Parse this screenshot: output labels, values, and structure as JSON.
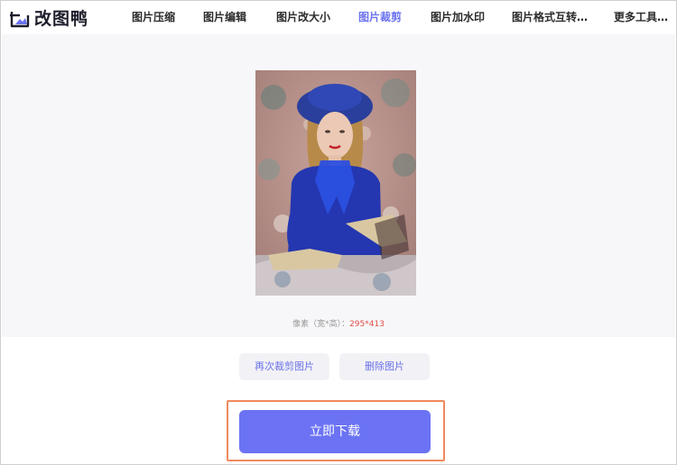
{
  "app": {
    "name": "改图鸭",
    "logo_icon": "image-duck-logo-icon"
  },
  "nav": [
    {
      "label": "图片压缩",
      "active": false
    },
    {
      "label": "图片编辑",
      "active": false
    },
    {
      "label": "图片改大小",
      "active": false
    },
    {
      "label": "图片裁剪",
      "active": true
    },
    {
      "label": "图片加水印",
      "active": false
    },
    {
      "label": "图片格式互转…",
      "active": false
    },
    {
      "label": "更多工具…",
      "active": false
    }
  ],
  "preview": {
    "pixel_label": "像素（宽*高）：",
    "pixel_value": "295*413"
  },
  "actions": {
    "recrop_label": "再次裁剪图片",
    "delete_label": "删除图片",
    "download_label": "立即下载"
  },
  "colors": {
    "accent": "#6c73ef",
    "download_button": "#6b73f4",
    "highlight_border": "#f08a5d",
    "pixel_value": "#e0504b"
  }
}
